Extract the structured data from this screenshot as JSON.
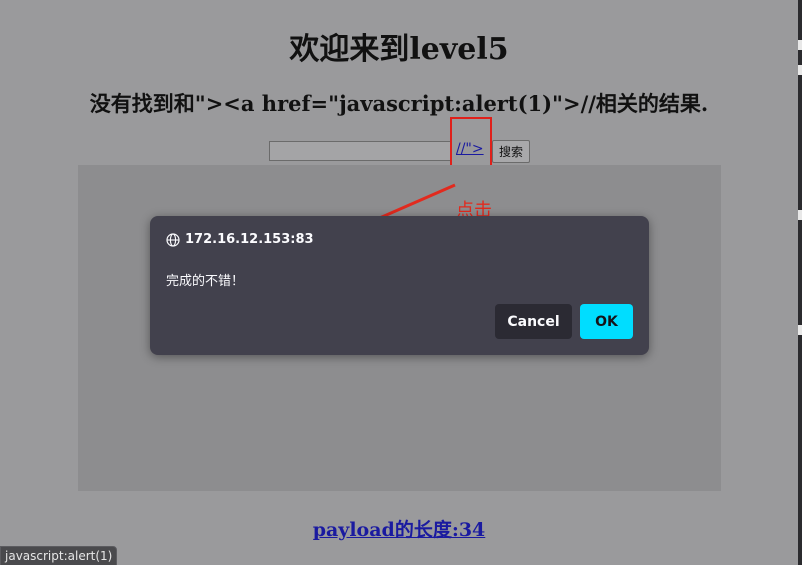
{
  "page": {
    "title": "欢迎来到level5",
    "result_text": "没有找到和\"><a href=\"javascript:alert(1)\">//相关的结果.",
    "search_value": "",
    "injected_link_text": "//\">",
    "search_button_label": "搜索",
    "payload_length_text": "payload的长度:34"
  },
  "annotation": {
    "label": "点击",
    "color": "#e22a1e"
  },
  "dialog": {
    "origin": "172.16.12.153:83",
    "message": "完成的不错！",
    "cancel_label": "Cancel",
    "ok_label": "OK",
    "ok_color": "#00ddff"
  },
  "statusbar": {
    "url": "javascript:alert(1)"
  }
}
